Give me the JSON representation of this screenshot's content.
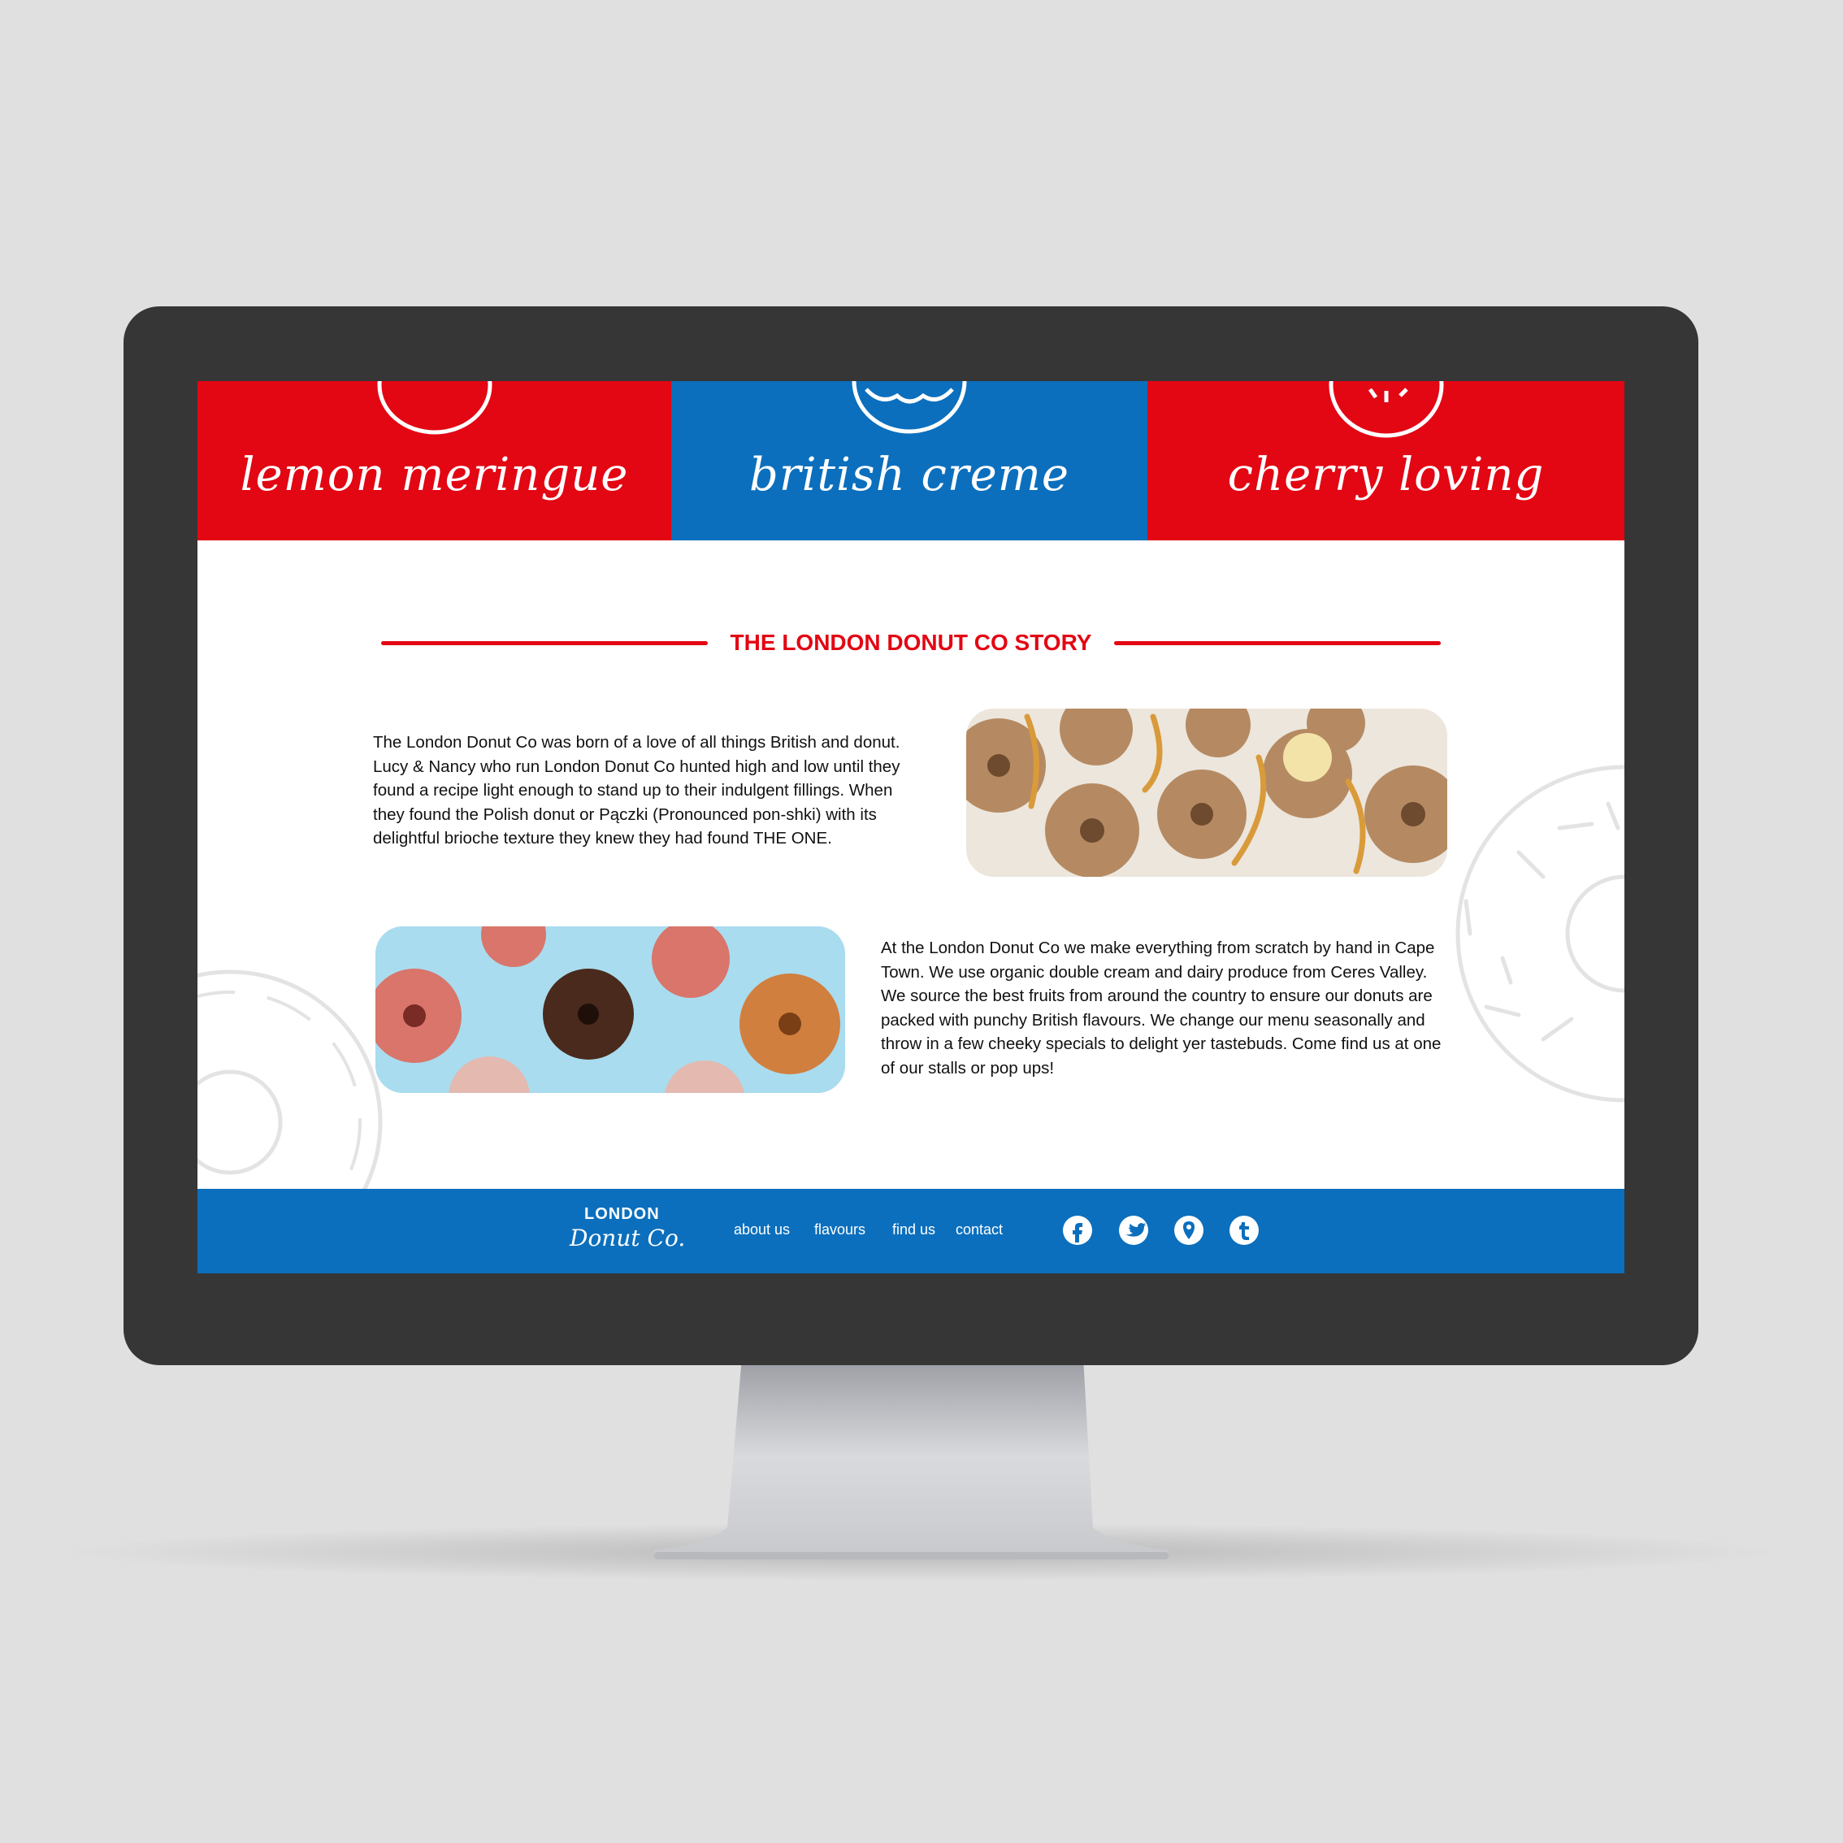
{
  "flavours": [
    {
      "label": "lemon meringue"
    },
    {
      "label": "british creme"
    },
    {
      "label": "cherry loving"
    }
  ],
  "story": {
    "title": "THE LONDON DONUT CO STORY",
    "paragraph1": "The London Donut Co was born of a love of all things British and donut.  Lucy & Nancy who run London Donut Co hunted high and low until they found a recipe light enough to stand up to their indulgent fillings. When they found the Polish donut or Pączki (Pronounced pon-shki) with its delightful brioche texture they knew they had found THE ONE.",
    "paragraph2": "At the London Donut Co we make everything from scratch by hand in Cape Town. We use organic double cream and dairy produce from Ceres Valley. We source the best fruits from around the country to ensure our donuts are packed with punchy British flavours. We change our menu seasonally and throw in a few cheeky specials to delight yer tastebuds. Come find us at one of our stalls or pop ups!"
  },
  "footer": {
    "logo_top": "LONDON",
    "logo_bottom": "Donut Co.",
    "nav": [
      "about us",
      "flavours",
      "find us",
      "contact"
    ],
    "social_icons": [
      "facebook-icon",
      "twitter-icon",
      "location-pin-icon",
      "tumblr-icon"
    ]
  },
  "colors": {
    "red": "#e30613",
    "blue": "#0b6fbd",
    "bezel": "#363636",
    "background": "#e0e0e0"
  }
}
